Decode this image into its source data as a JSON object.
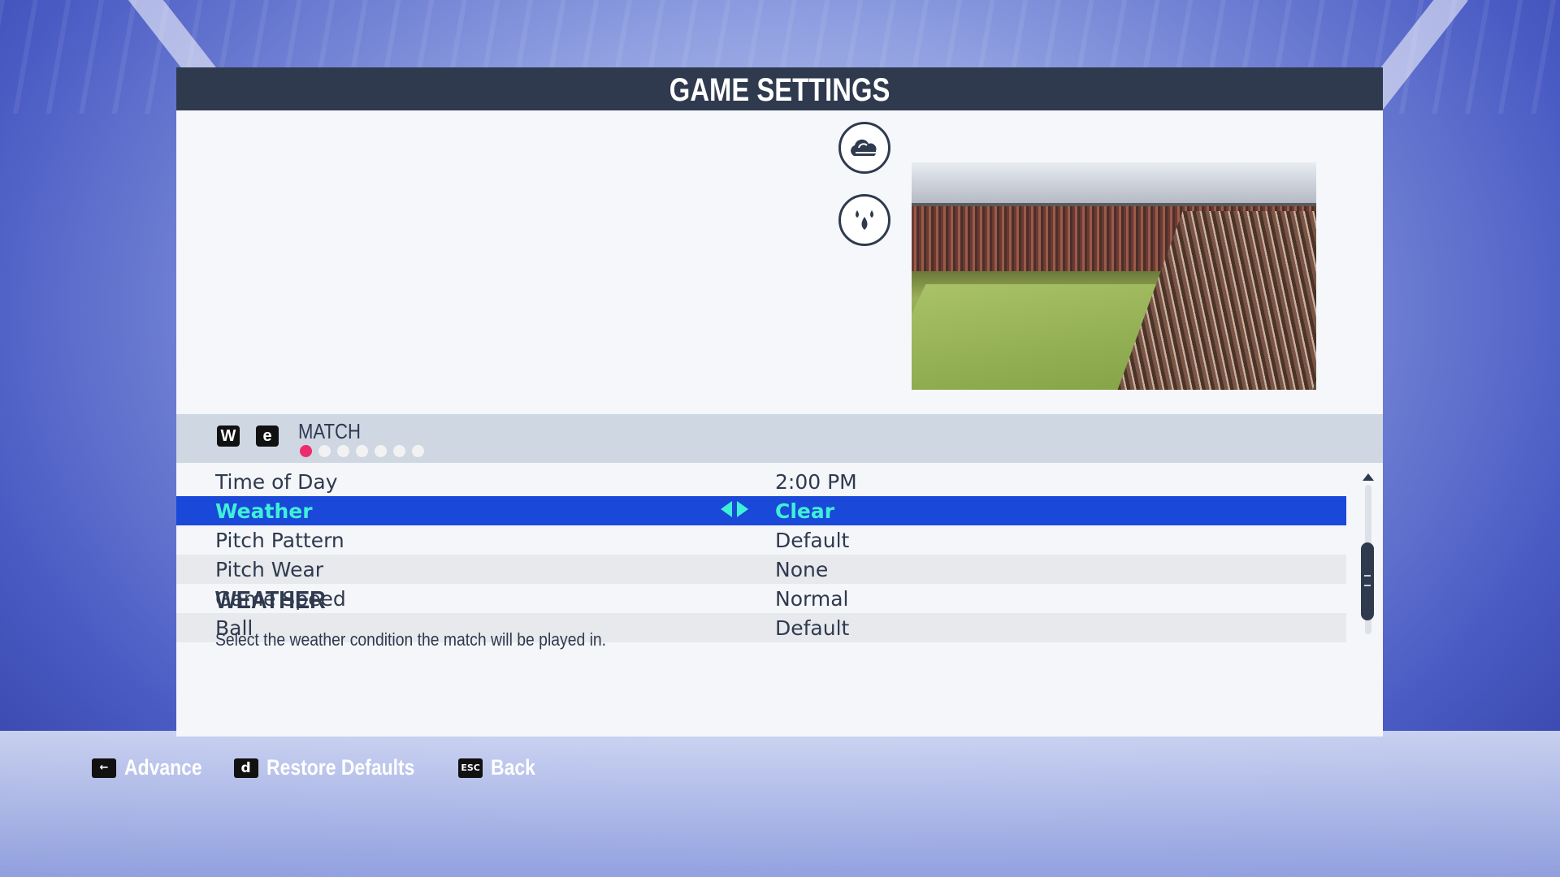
{
  "header": {
    "title": "GAME SETTINGS"
  },
  "tabs": {
    "prev_key": "W",
    "next_key": "e",
    "current_label": "MATCH",
    "page_count": 7,
    "current_page": 1
  },
  "settings": [
    {
      "label": "Time of Day",
      "value": "2:00 PM",
      "selected": false
    },
    {
      "label": "Weather",
      "value": "Clear",
      "selected": true
    },
    {
      "label": "Pitch Pattern",
      "value": "Default",
      "selected": false
    },
    {
      "label": "Pitch Wear",
      "value": "None",
      "selected": false
    },
    {
      "label": "Game Speed",
      "value": "Normal",
      "selected": false
    },
    {
      "label": "Ball",
      "value": "Default",
      "selected": false
    }
  ],
  "description": {
    "title": "WEATHER",
    "text": "Select the weather condition the match will be played in."
  },
  "footer": {
    "advance_key": "←",
    "advance_label": "Advance",
    "restore_key": "d",
    "restore_label": "Restore Defaults",
    "back_key": "ESC",
    "back_label": "Back"
  },
  "icons": [
    "cloudy-weather-icon",
    "raindrops-icon"
  ],
  "colors": {
    "title_bar": "#2f3a4f",
    "selected_row": "#1a48d8",
    "selected_text": "#3ff0d7",
    "active_dot": "#ec2c6c"
  }
}
